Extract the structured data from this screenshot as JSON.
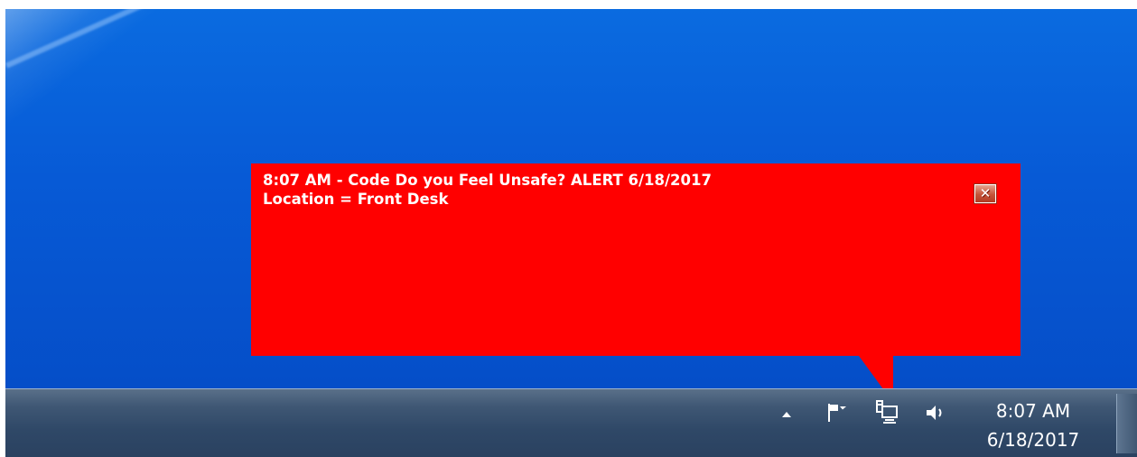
{
  "alert": {
    "line1": "8:07 AM - Code Do you Feel Unsafe? ALERT 6/18/2017",
    "line2": "Location = Front Desk",
    "close_label": "✕",
    "background_color": "#ff0000",
    "text_color": "#ffffff"
  },
  "taskbar": {
    "tray_icons": [
      "show-hidden-icons-arrow",
      "action-center-flag-icon",
      "network-icon",
      "volume-icon"
    ],
    "clock": {
      "time": "8:07 AM",
      "date": "6/18/2017"
    }
  }
}
